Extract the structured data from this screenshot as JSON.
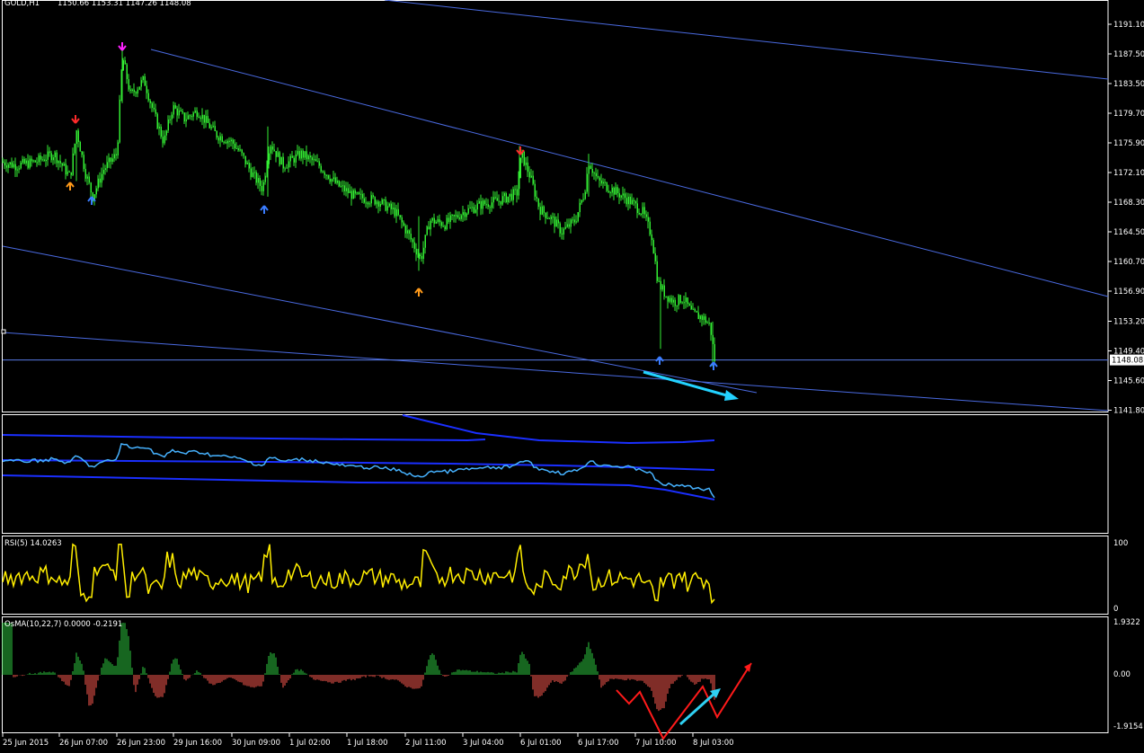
{
  "colors": {
    "background": "#000000",
    "grid_frame": "#ffffff",
    "candle": "#33ee33",
    "channel": "#4a6ae0",
    "price_line": "#5a7be8",
    "arrow_up_blue": "#3a7cff",
    "arrow_up_orange": "#ff9a1a",
    "arrow_down_red": "#ff2b2b",
    "arrow_down_magenta": "#ff22ff",
    "cyan_arrow": "#23d2ff",
    "indicator_line": "#46b2ff",
    "band_line": "#1a2fff",
    "rsi_line": "#ffee00",
    "osma_pos": "#2ecc40",
    "osma_neg": "#ff5a50",
    "annotation_red": "#ff1a1a",
    "annotation_cyan": "#2fd0f2",
    "price_box_bg": "#ffffff",
    "price_box_text": "#000000"
  },
  "header": {
    "symbol_label": "GOLD,H1",
    "ohlc": "1150.66 1153.31 1147.26 1148.08"
  },
  "price_axis": {
    "ticks": [
      "1191.10",
      "1187.50",
      "1183.50",
      "1179.70",
      "1175.90",
      "1172.10",
      "1168.30",
      "1164.50",
      "1160.70",
      "1156.90",
      "1153.20",
      "1149.40",
      "1145.60",
      "1141.80"
    ],
    "current_price": "1148.08"
  },
  "time_axis": {
    "ticks": [
      "25 Jun 2015",
      "26 Jun 07:00",
      "26 Jun 23:00",
      "29 Jun 16:00",
      "30 Jun 09:00",
      "1 Jul 02:00",
      "1 Jul 18:00",
      "2 Jul 11:00",
      "3 Jul 04:00",
      "6 Jul 01:00",
      "6 Jul 17:00",
      "7 Jul 10:00",
      "8 Jul 03:00"
    ]
  },
  "rsi_panel": {
    "label": "RSI(5) 14.0263",
    "ticks": [
      "100",
      "0"
    ]
  },
  "osma_panel": {
    "label": "OsMA(10,22,7) 0.0000 -0.2191",
    "ticks": [
      "1.9322",
      "0.00",
      "-1.9154"
    ]
  },
  "chart_data": [
    {
      "type": "candlestick",
      "symbol": "GOLD",
      "timeframe": "H1",
      "ylim": [
        1141.8,
        1191.1
      ],
      "x_ticks": [
        "25 Jun 2015",
        "26 Jun 07:00",
        "26 Jun 23:00",
        "29 Jun 16:00",
        "30 Jun 09:00",
        "1 Jul 02:00",
        "1 Jul 18:00",
        "2 Jul 11:00",
        "3 Jul 04:00",
        "6 Jul 01:00",
        "6 Jul 17:00",
        "7 Jul 10:00",
        "8 Jul 03:00"
      ],
      "price_path": [
        [
          0,
          1173.5
        ],
        [
          18,
          1173.0
        ],
        [
          40,
          1173.5
        ],
        [
          60,
          1174.5
        ],
        [
          78,
          1171.5
        ],
        [
          85,
          1177.5
        ],
        [
          95,
          1172.0
        ],
        [
          103,
          1169.0
        ],
        [
          115,
          1172.5
        ],
        [
          130,
          1174.5
        ],
        [
          136,
          1187.0
        ],
        [
          145,
          1182.0
        ],
        [
          160,
          1184.0
        ],
        [
          170,
          1180.0
        ],
        [
          182,
          1176.0
        ],
        [
          192,
          1180.5
        ],
        [
          205,
          1179.0
        ],
        [
          220,
          1180.0
        ],
        [
          240,
          1177.0
        ],
        [
          258,
          1176.0
        ],
        [
          268,
          1174.5
        ],
        [
          280,
          1172.0
        ],
        [
          292,
          1170.0
        ],
        [
          300,
          1176.0
        ],
        [
          315,
          1173.0
        ],
        [
          335,
          1174.5
        ],
        [
          355,
          1173.0
        ],
        [
          375,
          1170.5
        ],
        [
          395,
          1169.0
        ],
        [
          420,
          1168.5
        ],
        [
          440,
          1167.0
        ],
        [
          455,
          1164.0
        ],
        [
          468,
          1161.0
        ],
        [
          478,
          1166.0
        ],
        [
          495,
          1165.5
        ],
        [
          515,
          1167.0
        ],
        [
          535,
          1168.0
        ],
        [
          555,
          1168.5
        ],
        [
          575,
          1169.5
        ],
        [
          580,
          1174.5
        ],
        [
          590,
          1171.5
        ],
        [
          600,
          1167.5
        ],
        [
          615,
          1166.0
        ],
        [
          625,
          1164.5
        ],
        [
          640,
          1166.0
        ],
        [
          650,
          1169.5
        ],
        [
          655,
          1173.5
        ],
        [
          665,
          1171.0
        ],
        [
          680,
          1170.0
        ],
        [
          700,
          1168.5
        ],
        [
          715,
          1167.0
        ],
        [
          725,
          1164.0
        ],
        [
          732,
          1158.0
        ],
        [
          740,
          1156.5
        ],
        [
          750,
          1155.5
        ],
        [
          760,
          1156.0
        ],
        [
          770,
          1154.0
        ],
        [
          782,
          1153.5
        ],
        [
          790,
          1152.5
        ],
        [
          795,
          1148.08
        ]
      ],
      "extremes": {
        "low": 1147.26,
        "high_range_top": 1187.5
      },
      "arrows": [
        {
          "time_index": 78,
          "dir": "up",
          "color": "orange"
        },
        {
          "time_index": 84,
          "dir": "down",
          "color": "red"
        },
        {
          "time_index": 102,
          "dir": "up",
          "color": "blue"
        },
        {
          "time_index": 136,
          "dir": "down",
          "color": "magenta"
        },
        {
          "time_index": 294,
          "dir": "up",
          "color": "blue"
        },
        {
          "time_index": 466,
          "dir": "up",
          "color": "orange"
        },
        {
          "time_index": 579,
          "dir": "down",
          "color": "red"
        },
        {
          "time_index": 734,
          "dir": "up",
          "color": "blue"
        },
        {
          "time_index": 794,
          "dir": "up",
          "color": "blue"
        }
      ],
      "trendlines": 4,
      "current_price": 1148.08,
      "grid": false
    },
    {
      "type": "line",
      "panel": "envelope-indicator",
      "series_lines": 4
    },
    {
      "type": "line",
      "panel": "RSI",
      "title": "RSI(5) 14.0263",
      "ylim": [
        0,
        100
      ],
      "last_value": 14.0263
    },
    {
      "type": "bar",
      "panel": "OsMA",
      "title": "OsMA(10,22,7) 0.0000 -0.2191",
      "ylim": [
        -1.9154,
        1.9322
      ],
      "values_shown": [
        0.0,
        -0.2191
      ]
    }
  ]
}
